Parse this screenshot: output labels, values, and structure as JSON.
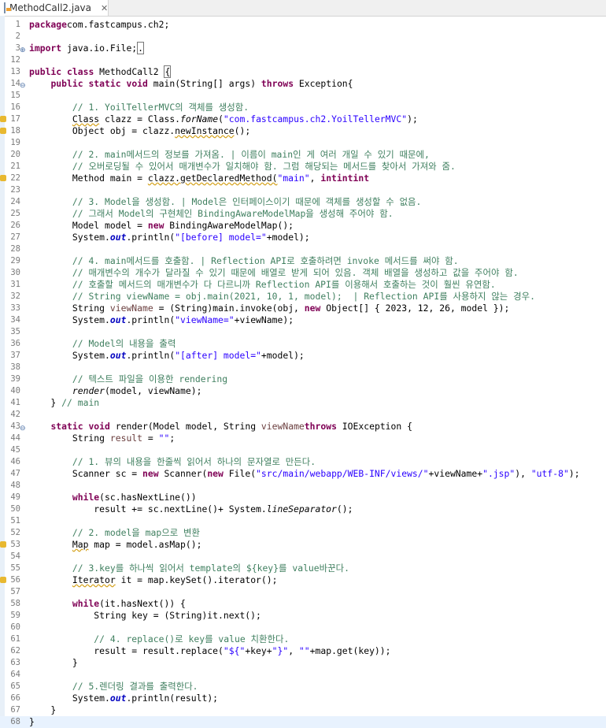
{
  "tab": {
    "title": "MethodCall2.java",
    "close": "✕"
  },
  "lines": [
    {
      "n": "1",
      "tokens": [
        [
          "kw",
          "package"
        ],
        [
          "",
          "com.fastcampus.ch2;"
        ]
      ]
    },
    {
      "n": "2",
      "tokens": []
    },
    {
      "n": "3",
      "fold": "⊕",
      "tokens": [
        [
          "kw",
          "import"
        ],
        [
          "",
          " java.io.File;"
        ],
        [
          "box",
          "."
        ]
      ]
    },
    {
      "n": "12",
      "tokens": []
    },
    {
      "n": "13",
      "tokens": [
        [
          "kw",
          "public"
        ],
        [
          "",
          " "
        ],
        [
          "kw",
          "class"
        ],
        [
          "",
          " MethodCall2 "
        ],
        [
          "box",
          "{"
        ]
      ]
    },
    {
      "n": "14",
      "fold": "⊖",
      "tokens": [
        [
          "",
          "    "
        ],
        [
          "kw",
          "public"
        ],
        [
          "",
          " "
        ],
        [
          "kw",
          "static"
        ],
        [
          "",
          " "
        ],
        [
          "kw",
          "void"
        ],
        [
          "",
          " main(String[] args) "
        ],
        [
          "kw",
          "throws"
        ],
        [
          "",
          " Exception{"
        ]
      ]
    },
    {
      "n": "15",
      "tokens": []
    },
    {
      "n": "16",
      "tokens": [
        [
          "",
          "        "
        ],
        [
          "cm",
          "// 1. YoilTellerMVC의 객체를 생성함."
        ]
      ]
    },
    {
      "n": "17",
      "warn": true,
      "tokens": [
        [
          "",
          "        "
        ],
        [
          "warnu",
          "Class"
        ],
        [
          "",
          " clazz = Class."
        ],
        [
          "it",
          "forName"
        ],
        [
          "",
          "("
        ],
        [
          "str",
          "\"com.fastcampus.ch2.YoilTellerMVC\""
        ],
        [
          "",
          ");"
        ]
      ]
    },
    {
      "n": "18",
      "warn": true,
      "tokens": [
        [
          "",
          "        Object obj = clazz."
        ],
        [
          "warnu",
          "newInstance"
        ],
        [
          "",
          "();"
        ]
      ]
    },
    {
      "n": "19",
      "tokens": []
    },
    {
      "n": "20",
      "tokens": [
        [
          "",
          "        "
        ],
        [
          "cm",
          "// 2. main메서드의 정보를 가져옴. | 이름이 main인 게 여러 개일 수 있기 때문에,"
        ]
      ]
    },
    {
      "n": "21",
      "tokens": [
        [
          "",
          "        "
        ],
        [
          "cm",
          "// 오버로딩될 수 있어서 매개변수가 일치해야 함. 그럼 해당되는 메서드를 찾아서 가져와 줌."
        ]
      ]
    },
    {
      "n": "22",
      "warn": true,
      "tokens": [
        [
          "",
          "        Method main = "
        ],
        [
          "warnu",
          "clazz.getDeclaredMethod("
        ],
        [
          "str",
          "\"main\""
        ],
        [
          "",
          ", "
        ],
        [
          "kw",
          "int"
        ],
        [
          ".class, "
        ],
        [
          "kw",
          "int"
        ],
        [
          ".class, "
        ],
        [
          "kw",
          "int"
        ],
        [
          ".class, Model.class);"
        ]
      ]
    },
    {
      "n": "23",
      "tokens": []
    },
    {
      "n": "24",
      "tokens": [
        [
          "",
          "        "
        ],
        [
          "cm",
          "// 3. Model을 생성함. | Model은 인터페이스이기 때문에 객체를 생성할 수 없음."
        ]
      ]
    },
    {
      "n": "25",
      "tokens": [
        [
          "",
          "        "
        ],
        [
          "cm",
          "// 그래서 Model의 구현체인 BindingAwareModelMap을 생성해 주어야 함."
        ]
      ]
    },
    {
      "n": "26",
      "tokens": [
        [
          "",
          "        Model model = "
        ],
        [
          "kw",
          "new"
        ],
        [
          "",
          " BindingAwareModelMap();"
        ]
      ]
    },
    {
      "n": "27",
      "tokens": [
        [
          "",
          "        System."
        ],
        [
          "fld",
          "out"
        ],
        [
          "",
          ".println("
        ],
        [
          "str",
          "\"[before] model=\""
        ],
        [
          "",
          "+model);"
        ]
      ]
    },
    {
      "n": "28",
      "tokens": []
    },
    {
      "n": "29",
      "tokens": [
        [
          "",
          "        "
        ],
        [
          "cm",
          "// 4. main메서드를 호출함. | Reflection API로 호출하려면 invoke 메서드를 써야 함."
        ]
      ]
    },
    {
      "n": "30",
      "tokens": [
        [
          "",
          "        "
        ],
        [
          "cm",
          "// 매개변수의 개수가 달라질 수 있기 때문에 배열로 받게 되어 있음. 객체 배열을 생성하고 값을 주어야 함."
        ]
      ]
    },
    {
      "n": "31",
      "tokens": [
        [
          "",
          "        "
        ],
        [
          "cm",
          "// 호출할 메서드의 매개변수가 다 다르니까 Reflection API를 이용해서 호출하는 것이 훨씬 유연함."
        ]
      ]
    },
    {
      "n": "32",
      "tokens": [
        [
          "",
          "        "
        ],
        [
          "cm",
          "// String viewName = obj.main(2021, 10, 1, model);  | Reflection API를 사용하지 않는 경우."
        ]
      ]
    },
    {
      "n": "33",
      "tokens": [
        [
          "",
          "        String "
        ],
        [
          "var",
          "viewName"
        ],
        [
          "",
          " = (String)main.invoke(obj, "
        ],
        [
          "kw",
          "new"
        ],
        [
          "",
          " Object[] { 2023, 12, 26, model });"
        ]
      ]
    },
    {
      "n": "34",
      "tokens": [
        [
          "",
          "        System."
        ],
        [
          "fld",
          "out"
        ],
        [
          "",
          ".println("
        ],
        [
          "str",
          "\"viewName=\""
        ],
        [
          "",
          "+viewName);"
        ]
      ]
    },
    {
      "n": "35",
      "tokens": []
    },
    {
      "n": "36",
      "tokens": [
        [
          "",
          "        "
        ],
        [
          "cm",
          "// Model의 내용을 출력"
        ]
      ]
    },
    {
      "n": "37",
      "tokens": [
        [
          "",
          "        System."
        ],
        [
          "fld",
          "out"
        ],
        [
          "",
          ".println("
        ],
        [
          "str",
          "\"[after] model=\""
        ],
        [
          "",
          "+model);"
        ]
      ]
    },
    {
      "n": "38",
      "tokens": []
    },
    {
      "n": "39",
      "tokens": [
        [
          "",
          "        "
        ],
        [
          "cm",
          "// 텍스트 파일을 이용한 rendering"
        ]
      ]
    },
    {
      "n": "40",
      "tokens": [
        [
          "",
          "        "
        ],
        [
          "it",
          "render"
        ],
        [
          "",
          "(model, viewName);"
        ]
      ]
    },
    {
      "n": "41",
      "tokens": [
        [
          "",
          "    } "
        ],
        [
          "cm",
          "// main"
        ]
      ]
    },
    {
      "n": "42",
      "tokens": []
    },
    {
      "n": "43",
      "fold": "⊖",
      "tokens": [
        [
          "",
          "    "
        ],
        [
          "kw",
          "static"
        ],
        [
          "",
          " "
        ],
        [
          "kw",
          "void"
        ],
        [
          "",
          " render(Model model, String "
        ],
        [
          "var",
          "viewName"
        ],
        [
          ") "
        ],
        [
          "kw",
          "throws"
        ],
        [
          "",
          " IOException {"
        ]
      ]
    },
    {
      "n": "44",
      "tokens": [
        [
          "",
          "        String "
        ],
        [
          "var",
          "result"
        ],
        [
          "",
          " = "
        ],
        [
          "str",
          "\"\""
        ],
        [
          "",
          ";"
        ]
      ]
    },
    {
      "n": "45",
      "tokens": []
    },
    {
      "n": "46",
      "tokens": [
        [
          "",
          "        "
        ],
        [
          "cm",
          "// 1. 뷰의 내용을 한줄씩 읽어서 하나의 문자열로 만든다."
        ]
      ]
    },
    {
      "n": "47",
      "tokens": [
        [
          "",
          "        Scanner sc = "
        ],
        [
          "kw",
          "new"
        ],
        [
          "",
          " Scanner("
        ],
        [
          "kw",
          "new"
        ],
        [
          "",
          " File("
        ],
        [
          "str",
          "\"src/main/webapp/WEB-INF/views/\""
        ],
        [
          "",
          "+viewName+"
        ],
        [
          "str",
          "\".jsp\""
        ],
        [
          "",
          "), "
        ],
        [
          "str",
          "\"utf-8\""
        ],
        [
          "",
          ");"
        ]
      ]
    },
    {
      "n": "48",
      "tokens": []
    },
    {
      "n": "49",
      "tokens": [
        [
          "",
          "        "
        ],
        [
          "kw",
          "while"
        ],
        [
          "",
          "(sc.hasNextLine())"
        ]
      ]
    },
    {
      "n": "50",
      "tokens": [
        [
          "",
          "            result += sc.nextLine()+ System."
        ],
        [
          "it",
          "lineSeparator"
        ],
        [
          "",
          "();"
        ]
      ]
    },
    {
      "n": "51",
      "tokens": []
    },
    {
      "n": "52",
      "tokens": [
        [
          "",
          "        "
        ],
        [
          "cm",
          "// 2. model을 map으로 변환"
        ]
      ]
    },
    {
      "n": "53",
      "warn": true,
      "tokens": [
        [
          "",
          "        "
        ],
        [
          "warnu",
          "Map"
        ],
        [
          "",
          " map = model.asMap();"
        ]
      ]
    },
    {
      "n": "54",
      "tokens": []
    },
    {
      "n": "55",
      "tokens": [
        [
          "",
          "        "
        ],
        [
          "cm",
          "// 3.key를 하나씩 읽어서 template의 ${key}를 value바꾼다."
        ]
      ]
    },
    {
      "n": "56",
      "warn": true,
      "tokens": [
        [
          "",
          "        "
        ],
        [
          "warnu",
          "Iterator"
        ],
        [
          "",
          " it = map.keySet().iterator();"
        ]
      ]
    },
    {
      "n": "57",
      "tokens": []
    },
    {
      "n": "58",
      "tokens": [
        [
          "",
          "        "
        ],
        [
          "kw",
          "while"
        ],
        [
          "",
          "(it.hasNext()) {"
        ]
      ]
    },
    {
      "n": "59",
      "tokens": [
        [
          "",
          "            String key = (String)it.next();"
        ]
      ]
    },
    {
      "n": "60",
      "tokens": []
    },
    {
      "n": "61",
      "tokens": [
        [
          "",
          "            "
        ],
        [
          "cm",
          "// 4. replace()로 key를 value 치환한다."
        ]
      ]
    },
    {
      "n": "62",
      "tokens": [
        [
          "",
          "            result = result.replace("
        ],
        [
          "str",
          "\"${\""
        ],
        [
          "",
          "+key+"
        ],
        [
          "str",
          "\"}\""
        ],
        [
          "",
          ", "
        ],
        [
          "str",
          "\"\""
        ],
        [
          "",
          "+map.get(key));"
        ]
      ]
    },
    {
      "n": "63",
      "tokens": [
        [
          "",
          "        }"
        ]
      ]
    },
    {
      "n": "64",
      "tokens": []
    },
    {
      "n": "65",
      "tokens": [
        [
          "",
          "        "
        ],
        [
          "cm",
          "// 5.렌더링 결과를 출력한다."
        ]
      ]
    },
    {
      "n": "66",
      "tokens": [
        [
          "",
          "        System."
        ],
        [
          "fld",
          "out"
        ],
        [
          "",
          ".println(result);"
        ]
      ]
    },
    {
      "n": "67",
      "tokens": [
        [
          "",
          "    }"
        ]
      ]
    },
    {
      "n": "68",
      "hl": true,
      "tokens": [
        [
          "",
          "}"
        ]
      ]
    }
  ]
}
